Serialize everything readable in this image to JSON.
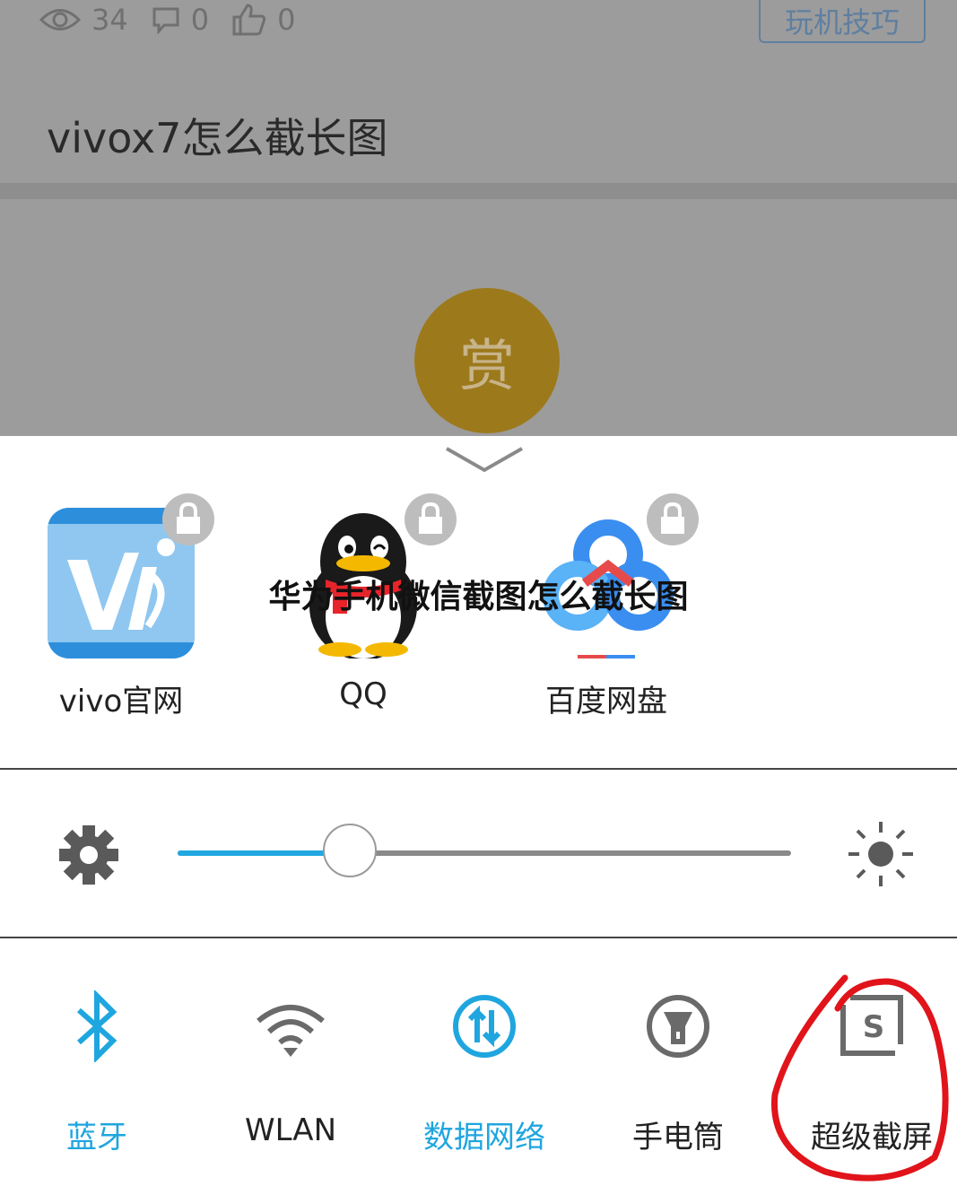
{
  "article": {
    "views": "34",
    "comments": "0",
    "likes": "0",
    "tag_button": "玩机技巧",
    "title": "vivox7怎么截长图",
    "reward_label": "赏"
  },
  "overlay_title": "华为手机微信截图怎么截长图",
  "apps": [
    {
      "label": "vivo官网",
      "icon": "vivo-app-icon",
      "locked": true
    },
    {
      "label": "QQ",
      "icon": "qq-penguin-icon",
      "locked": true
    },
    {
      "label": "百度网盘",
      "icon": "baidu-netdisk-icon",
      "locked": true
    }
  ],
  "brightness": {
    "level": 0.28
  },
  "toggles": [
    {
      "label": "蓝牙",
      "icon": "bluetooth-icon",
      "active": true
    },
    {
      "label": "WLAN",
      "icon": "wifi-icon",
      "active": false
    },
    {
      "label": "数据网络",
      "icon": "mobile-data-icon",
      "active": true
    },
    {
      "label": "手电筒",
      "icon": "flashlight-icon",
      "active": false
    },
    {
      "label": "超级截屏",
      "icon": "super-screenshot-icon",
      "active": false
    }
  ],
  "colors": {
    "accent": "#1fa6df",
    "annotation": "#e0141a",
    "reward": "#9c7a1c"
  }
}
